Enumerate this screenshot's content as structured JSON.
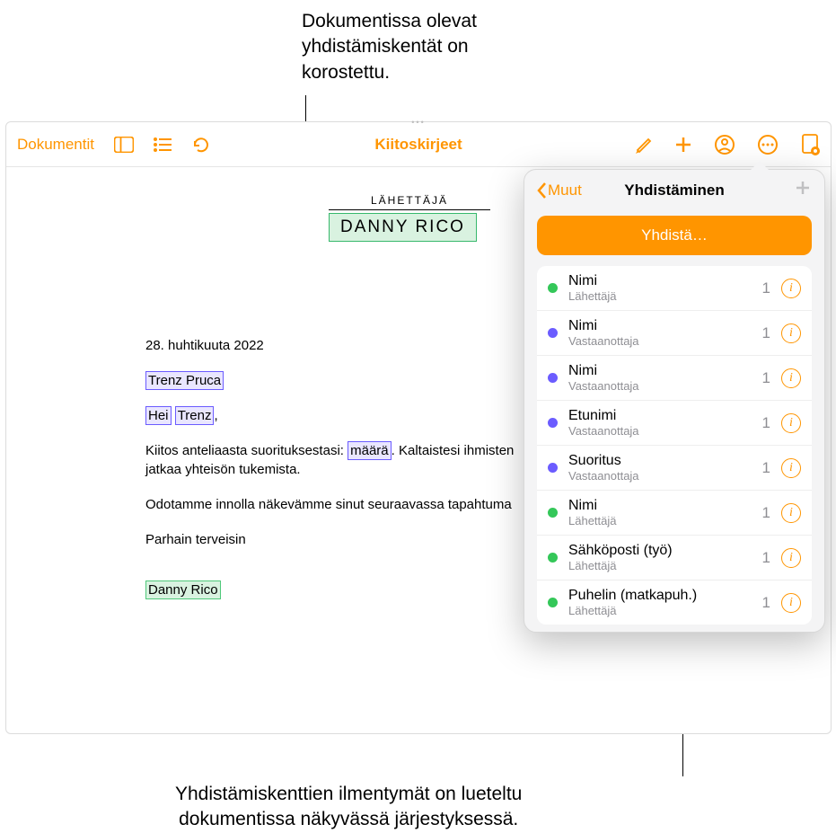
{
  "callouts": {
    "top": "Dokumentissa olevat\nyhdistämiskentät on\nkorostettu.",
    "bottom": "Yhdistämiskenttien ilmentymät on lueteltu\ndokumentissa näkyvässä järjestyksessä."
  },
  "toolbar": {
    "documents_label": "Dokumentit",
    "title": "Kiitoskirjeet"
  },
  "document": {
    "sender_label": "LÄHETTÄJÄ",
    "sender_name": "DANNY RICO",
    "date": "28. huhtikuuta 2022",
    "recipient_name": "Trenz Pruca",
    "greeting_prefix": "Hei",
    "greeting_name": "Trenz",
    "greeting_suffix": ",",
    "body_line1_a": "Kiitos anteliaasta suorituksestasi:",
    "body_line1_field": "määrä",
    "body_line1_b": ". Kaltaistesi ihmisten",
    "body_line2": "jatkaa yhteisön tukemista.",
    "body_line3": "Odotamme innolla näkevämme sinut seuraavassa tapahtuma",
    "signoff": "Parhain terveisin",
    "signature_name": "Danny Rico"
  },
  "popover": {
    "back_label": "Muut",
    "title": "Yhdistäminen",
    "action_button": "Yhdistä…",
    "fields": [
      {
        "name": "Nimi",
        "sub": "Lähettäjä",
        "count": "1",
        "color": "green"
      },
      {
        "name": "Nimi",
        "sub": "Vastaanottaja",
        "count": "1",
        "color": "purple"
      },
      {
        "name": "Nimi",
        "sub": "Vastaanottaja",
        "count": "1",
        "color": "purple"
      },
      {
        "name": "Etunimi",
        "sub": "Vastaanottaja",
        "count": "1",
        "color": "purple"
      },
      {
        "name": "Suoritus",
        "sub": "Vastaanottaja",
        "count": "1",
        "color": "purple"
      },
      {
        "name": "Nimi",
        "sub": "Lähettäjä",
        "count": "1",
        "color": "green"
      },
      {
        "name": "Sähköposti (työ)",
        "sub": "Lähettäjä",
        "count": "1",
        "color": "green"
      },
      {
        "name": "Puhelin (matkapuh.)",
        "sub": "Lähettäjä",
        "count": "1",
        "color": "green"
      }
    ]
  }
}
